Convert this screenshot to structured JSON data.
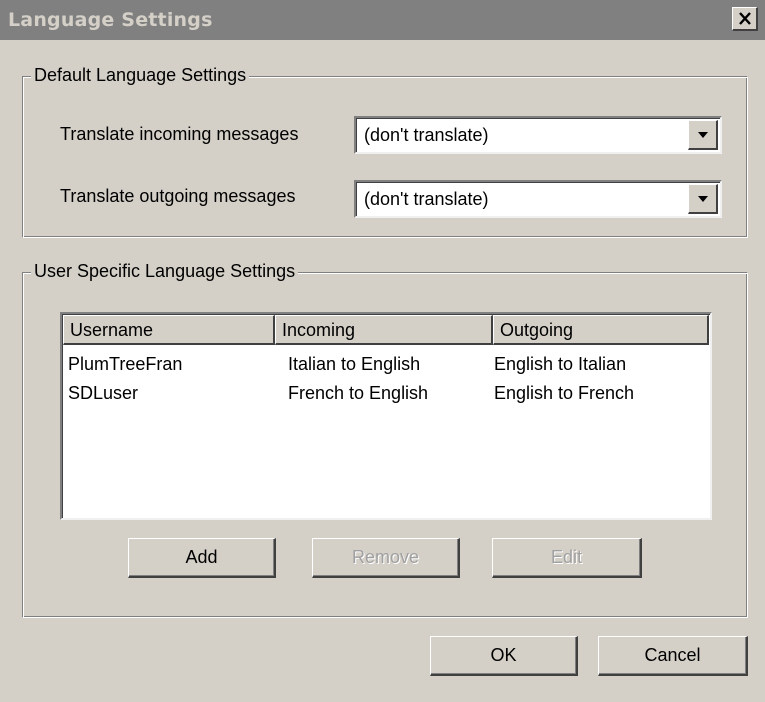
{
  "window": {
    "title": "Language Settings",
    "close_glyph": "✕"
  },
  "default_group": {
    "legend": "Default Language Settings",
    "incoming_label": "Translate incoming messages",
    "incoming_value": "(don't translate)",
    "outgoing_label": "Translate outgoing messages",
    "outgoing_value": "(don't translate)"
  },
  "user_group": {
    "legend": "User Specific Language Settings",
    "columns": [
      "Username",
      "Incoming",
      "Outgoing"
    ],
    "rows": [
      [
        "PlumTreeFran",
        "Italian to English",
        "English to Italian"
      ],
      [
        "SDLuser",
        "French to English",
        "English to French"
      ]
    ],
    "add_label": "Add",
    "remove_label": "Remove",
    "edit_label": "Edit"
  },
  "footer": {
    "ok_label": "OK",
    "cancel_label": "Cancel"
  },
  "icons": {
    "close": "close-icon",
    "dropdown": "chevron-down-icon"
  }
}
